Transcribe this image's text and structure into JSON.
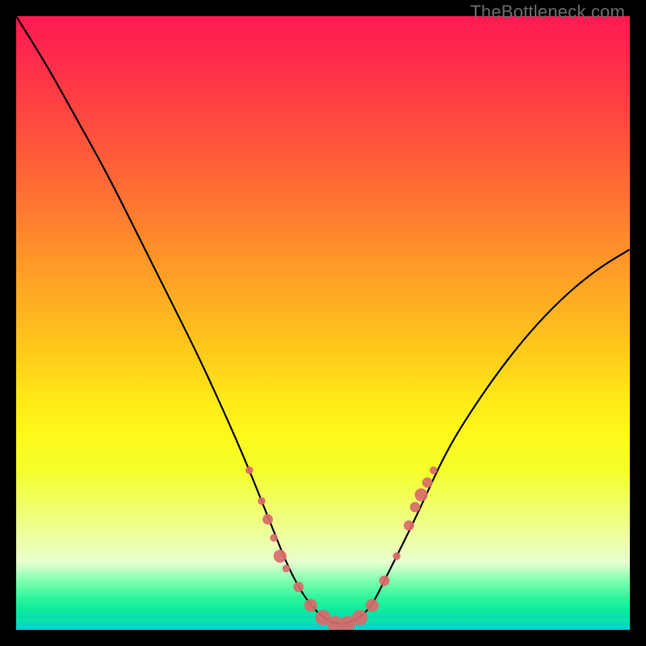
{
  "watermark": "TheBottleneck.com",
  "chart_data": {
    "type": "line",
    "title": "",
    "xlabel": "",
    "ylabel": "",
    "xlim": [
      0,
      100
    ],
    "ylim": [
      0,
      100
    ],
    "grid": false,
    "legend": false,
    "series": [
      {
        "name": "bottleneck-curve",
        "x": [
          0,
          5,
          10,
          15,
          20,
          25,
          30,
          35,
          38,
          40,
          42,
          44,
          46,
          48,
          50,
          52,
          54,
          56,
          58,
          60,
          65,
          70,
          75,
          80,
          85,
          90,
          95,
          100
        ],
        "y": [
          100,
          92,
          83,
          74,
          64,
          54,
          44,
          33,
          26,
          21,
          16,
          11,
          7,
          4,
          2,
          1,
          1,
          2,
          4,
          8,
          18,
          29,
          37,
          44,
          50,
          55,
          59,
          62
        ]
      }
    ],
    "markers": {
      "name": "highlighted-points",
      "color": "#d96a6a",
      "points": [
        {
          "x": 38,
          "y": 26,
          "r": 3
        },
        {
          "x": 40,
          "y": 21,
          "r": 3
        },
        {
          "x": 41,
          "y": 18,
          "r": 4
        },
        {
          "x": 42,
          "y": 15,
          "r": 3
        },
        {
          "x": 43,
          "y": 12,
          "r": 5
        },
        {
          "x": 44,
          "y": 10,
          "r": 3
        },
        {
          "x": 46,
          "y": 7,
          "r": 4
        },
        {
          "x": 48,
          "y": 4,
          "r": 5
        },
        {
          "x": 50,
          "y": 2,
          "r": 6
        },
        {
          "x": 52,
          "y": 1,
          "r": 6
        },
        {
          "x": 54,
          "y": 1,
          "r": 6
        },
        {
          "x": 56,
          "y": 2,
          "r": 6
        },
        {
          "x": 58,
          "y": 4,
          "r": 5
        },
        {
          "x": 60,
          "y": 8,
          "r": 4
        },
        {
          "x": 62,
          "y": 12,
          "r": 3
        },
        {
          "x": 64,
          "y": 17,
          "r": 4
        },
        {
          "x": 65,
          "y": 20,
          "r": 4
        },
        {
          "x": 66,
          "y": 22,
          "r": 5
        },
        {
          "x": 67,
          "y": 24,
          "r": 4
        },
        {
          "x": 68,
          "y": 26,
          "r": 3
        }
      ]
    },
    "gradient_stops": [
      {
        "pos": 0,
        "color": "#ff1a52"
      },
      {
        "pos": 50,
        "color": "#ffcf1a"
      },
      {
        "pos": 75,
        "color": "#f4ff2a"
      },
      {
        "pos": 95,
        "color": "#28f59a"
      },
      {
        "pos": 100,
        "color": "#04cfd8"
      }
    ]
  }
}
